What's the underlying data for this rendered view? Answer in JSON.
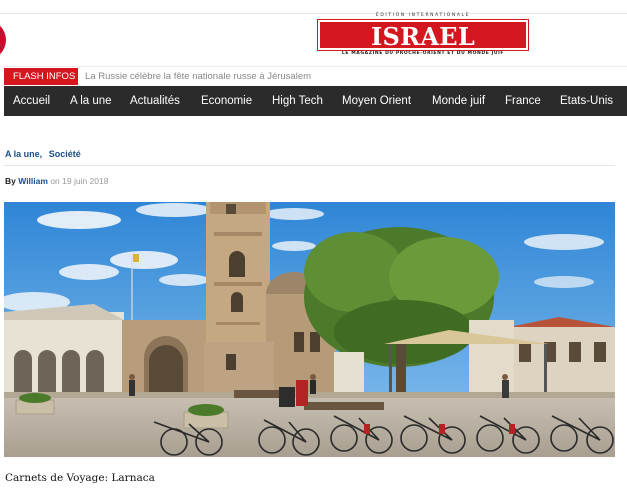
{
  "logo": {
    "edition": "ÉDITION INTERNATIONALE",
    "title": "ISRAEL MAGAZINE",
    "subtitle": "LE MAGAZINE DU PROCHE-ORIENT ET DU MONDE JUIF",
    "brand_color": "#d4171e"
  },
  "flash": {
    "label": "FLASH INFOS",
    "text": "La Russie célèbre la fête nationale russe à Jérusalem"
  },
  "nav": {
    "items": [
      "Accueil",
      "A la une",
      "Actualités",
      "Economie",
      "High Tech",
      "Moyen Orient",
      "Monde juif",
      "France",
      "Etats-Unis"
    ]
  },
  "article": {
    "categories": [
      "A la une,",
      "Société"
    ],
    "by_label": "By",
    "author": "William",
    "date": "on 19 juin 2018",
    "caption": "Carnets de Voyage: Larnaca"
  },
  "colors": {
    "accent": "#d4171e",
    "nav_bg": "#2b2b2b",
    "link": "#1b4f8a"
  }
}
